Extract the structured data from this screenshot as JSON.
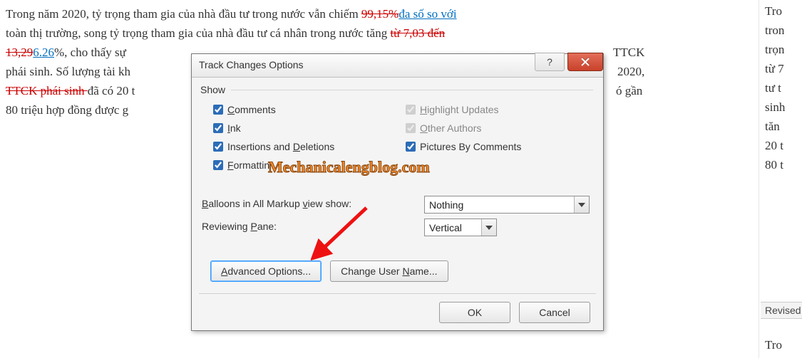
{
  "doc": {
    "l1a": "Trong năm 2020, tỷ trọng tham gia của nhà đầu tư trong nước vẫn chiếm ",
    "l1del": "99,15%",
    "l1ins": "đa số so với",
    "l2a": "toàn thị trường, song tỷ trọng tham gia của nhà đầu tư cá nhân trong nước tăng ",
    "l2del": "từ 7,03 đến",
    "l3del": "13,29",
    "l3ins": "6.26",
    "l3a": "%, cho thấy sự",
    "l3b": "TTCK",
    "l4a": "phái sinh. Số lượng tài kh",
    "l4b": "2020,",
    "l5del": "TTCK phái sinh ",
    "l5a": "đã có 20 t",
    "l5b": "ó gần",
    "l6a": "80 triệu hợp đồng được g"
  },
  "right": {
    "r1": "Tro",
    "r2": "tron",
    "r3": "trọn",
    "r4": "từ 7",
    "r5": "tư t",
    "r6": "sinh",
    "r7": "tăn",
    "r8": "20 t",
    "r9": "80 t",
    "rev": "Revised Doc",
    "r10": "Tro"
  },
  "dlg": {
    "title": "Track Changes Options",
    "group": "Show",
    "chk": {
      "comments": "omments",
      "ink": "nk",
      "insdel1": "Insertions and ",
      "insdel2": "eletions",
      "fmt1": "ormattin",
      "hu": "ighlight Updates",
      "oa": "ther Authors",
      "pbc": "Pictures By Comments"
    },
    "balloons_label1": "alloons in All Markup ",
    "balloons_label2": "iew show:",
    "balloons_value": "Nothing",
    "pane_label": "Reviewing ",
    "pane_u": "P",
    "pane_label2": "ane:",
    "pane_value": "Vertical",
    "adv": "dvanced Options...",
    "chguser1": "Change User ",
    "chguser2": "ame...",
    "ok": "OK",
    "cancel": "Cancel"
  },
  "watermark": "Mechanicalengblog.com"
}
